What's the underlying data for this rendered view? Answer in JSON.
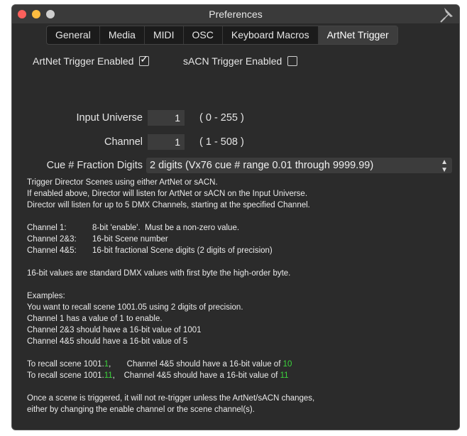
{
  "window": {
    "title": "Preferences"
  },
  "tabs": [
    "General",
    "Media",
    "MIDI",
    "OSC",
    "Keyboard Macros",
    "ArtNet Trigger"
  ],
  "active_tab": "ArtNet Trigger",
  "artnet": {
    "label": "ArtNet Trigger Enabled",
    "checked": true
  },
  "sacn": {
    "label": "sACN Trigger Enabled",
    "checked": false
  },
  "input_universe": {
    "label": "Input Universe",
    "value": "1",
    "range": "( 0 - 255 )"
  },
  "channel": {
    "label": "Channel",
    "value": "1",
    "range": "( 1 - 508 )"
  },
  "cue_fraction": {
    "label": "Cue # Fraction Digits",
    "value": "2 digits (Vx76 cue # range 0.01 through 9999.99)"
  },
  "help": {
    "intro": [
      "Trigger Director Scenes using either ArtNet or sACN.",
      "If enabled above, Director will listen for ArtNet or sACN on the Input Universe.",
      "Director will listen for up to 5 DMX Channels, starting at the specified Channel."
    ],
    "channels": [
      {
        "name": "Channel 1:",
        "desc": "8-bit 'enable'.  Must be a non-zero value."
      },
      {
        "name": "Channel 2&3:",
        "desc": "16-bit Scene number"
      },
      {
        "name": "Channel 4&5:",
        "desc": "16-bit fractional Scene digits (2 digits of precision)"
      }
    ],
    "note": "16-bit values are standard DMX values with first byte the high-order byte.",
    "examples": [
      "Examples:",
      "You want to recall scene 1001.05 using 2 digits of precision.",
      "Channel 1 has a value of 1 to enable.",
      "Channel 2&3 should have a 16-bit value of 1001",
      "Channel 4&5 should have a 16-bit value of 5"
    ],
    "recall": [
      {
        "prefix": "To recall scene 1001.",
        "suffix": "1",
        "mid": ",       Channel 4&5 should have a 16-bit value of ",
        "value": "10"
      },
      {
        "prefix": "To recall scene 1001.",
        "suffix": "11",
        "mid": ",    Channel 4&5 should have a 16-bit value of ",
        "value": "11"
      }
    ],
    "outro": [
      "Once a scene is triggered, it will not re-trigger unless the ArtNet/sACN changes,",
      "either by changing the enable channel or the scene channel(s)."
    ]
  },
  "colors": {
    "highlight": "#3cd63c",
    "background": "#2b2b2b"
  }
}
